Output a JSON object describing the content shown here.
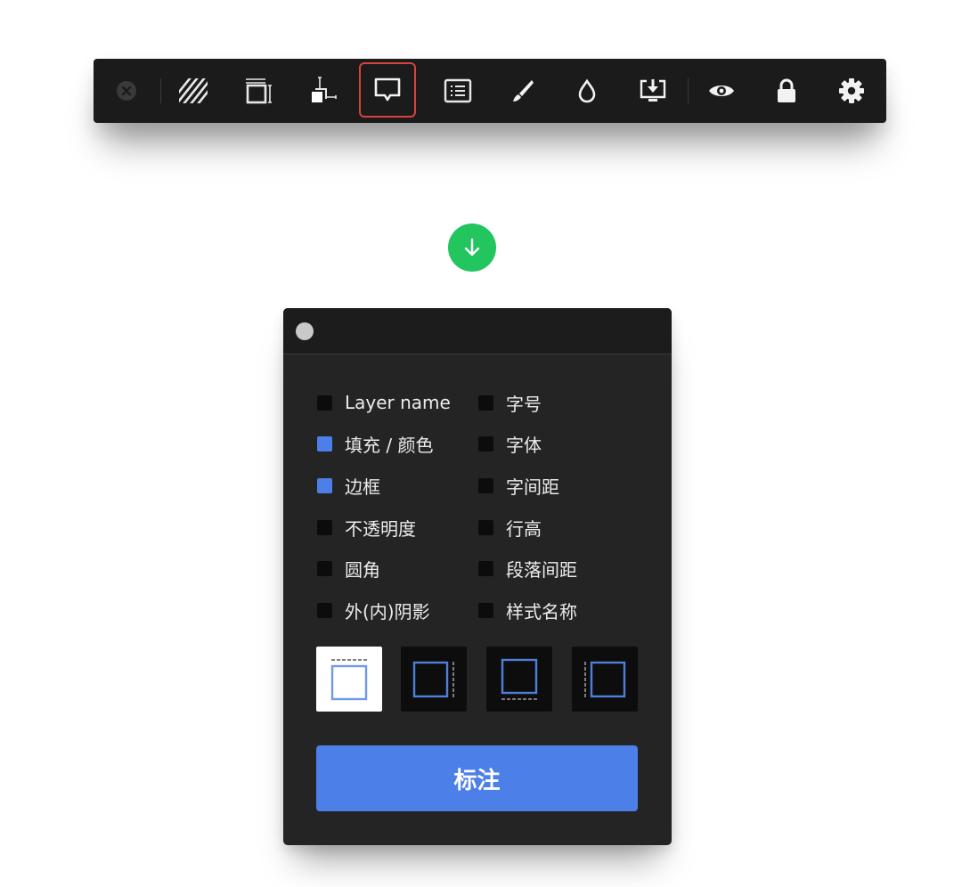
{
  "toolbar": {
    "items": [
      {
        "icon": "close-circle-icon"
      },
      {
        "icon": "hatch-pattern-icon"
      },
      {
        "icon": "frame-size-icon"
      },
      {
        "icon": "spacing-measure-icon"
      },
      {
        "icon": "comment-note-icon",
        "active": true
      },
      {
        "icon": "list-properties-icon"
      },
      {
        "icon": "brush-icon"
      },
      {
        "icon": "color-drop-icon"
      },
      {
        "icon": "export-download-icon"
      },
      {
        "icon": "eye-icon"
      },
      {
        "icon": "lock-icon"
      },
      {
        "icon": "gear-icon"
      }
    ],
    "active_highlight_color": "#d9423d"
  },
  "arrow": {
    "icon": "arrow-down-icon",
    "color": "#22c55e"
  },
  "panel": {
    "options_left": [
      {
        "label": "Layer name",
        "checked": false
      },
      {
        "label": "填充 / 颜色",
        "checked": true
      },
      {
        "label": "边框",
        "checked": true
      },
      {
        "label": "不透明度",
        "checked": false
      },
      {
        "label": "圆角",
        "checked": false
      },
      {
        "label": "外(内)阴影",
        "checked": false
      }
    ],
    "options_right": [
      {
        "label": "字号",
        "checked": false
      },
      {
        "label": "字体",
        "checked": false
      },
      {
        "label": "字间距",
        "checked": false
      },
      {
        "label": "行高",
        "checked": false
      },
      {
        "label": "段落间距",
        "checked": false
      },
      {
        "label": "样式名称",
        "checked": false
      }
    ],
    "positions": [
      {
        "icon": "label-top-icon",
        "selected": true
      },
      {
        "icon": "label-right-icon",
        "selected": false
      },
      {
        "icon": "label-bottom-icon",
        "selected": false
      },
      {
        "icon": "label-left-icon",
        "selected": false
      }
    ],
    "submit_label": "标注",
    "accent_color": "#4c7fe8"
  }
}
